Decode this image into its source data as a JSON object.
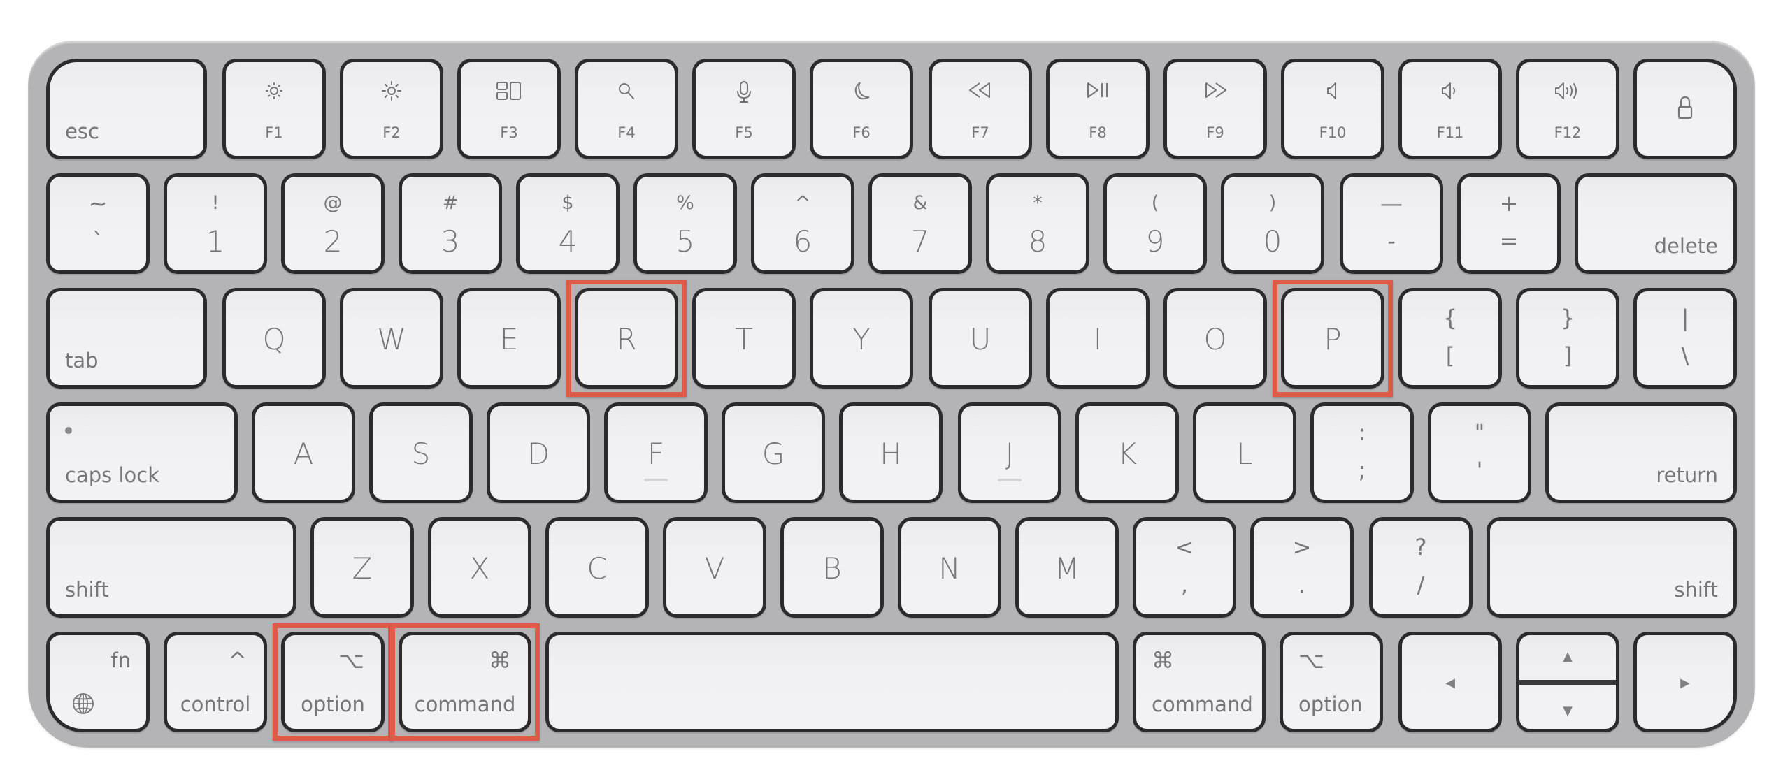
{
  "image": {
    "subject": "Apple Magic Keyboard layout with highlighted keys"
  },
  "colors": {
    "case": "#b4b4b6",
    "key_face": "#f1f1f4",
    "key_outline": "#2b2b2d",
    "legend": "#77777b",
    "highlight": "#e05a48"
  },
  "highlighted_keys": [
    "R",
    "P",
    "option-left",
    "command-left"
  ],
  "rows": [
    {
      "name": "function-row",
      "keys": [
        {
          "id": "esc",
          "label": "esc",
          "style": "mod-left"
        },
        {
          "id": "f1",
          "label": "F1",
          "icon": "brightness-down-icon",
          "style": "fkey"
        },
        {
          "id": "f2",
          "label": "F2",
          "icon": "brightness-up-icon",
          "style": "fkey"
        },
        {
          "id": "f3",
          "label": "F3",
          "icon": "mission-control-icon",
          "style": "fkey"
        },
        {
          "id": "f4",
          "label": "F4",
          "icon": "search-icon",
          "style": "fkey"
        },
        {
          "id": "f5",
          "label": "F5",
          "icon": "microphone-icon",
          "style": "fkey"
        },
        {
          "id": "f6",
          "label": "F6",
          "icon": "moon-icon",
          "style": "fkey"
        },
        {
          "id": "f7",
          "label": "F7",
          "icon": "rewind-icon",
          "style": "fkey"
        },
        {
          "id": "f8",
          "label": "F8",
          "icon": "play-pause-icon",
          "style": "fkey"
        },
        {
          "id": "f9",
          "label": "F9",
          "icon": "fast-forward-icon",
          "style": "fkey"
        },
        {
          "id": "f10",
          "label": "F10",
          "icon": "mute-icon",
          "style": "fkey"
        },
        {
          "id": "f11",
          "label": "F11",
          "icon": "volume-down-icon",
          "style": "fkey"
        },
        {
          "id": "f12",
          "label": "F12",
          "icon": "volume-up-icon",
          "style": "fkey"
        },
        {
          "id": "lock",
          "label": "",
          "icon": "lock-icon",
          "style": "lock"
        }
      ]
    },
    {
      "name": "number-row",
      "keys": [
        {
          "id": "grave",
          "top": "~",
          "bottom": "`",
          "style": "dual"
        },
        {
          "id": "1",
          "top": "!",
          "bottom": "1",
          "style": "dual-num"
        },
        {
          "id": "2",
          "top": "@",
          "bottom": "2",
          "style": "dual-num"
        },
        {
          "id": "3",
          "top": "#",
          "bottom": "3",
          "style": "dual-num"
        },
        {
          "id": "4",
          "top": "$",
          "bottom": "4",
          "style": "dual-num"
        },
        {
          "id": "5",
          "top": "%",
          "bottom": "5",
          "style": "dual-num"
        },
        {
          "id": "6",
          "top": "^",
          "bottom": "6",
          "style": "dual-num"
        },
        {
          "id": "7",
          "top": "&",
          "bottom": "7",
          "style": "dual-num"
        },
        {
          "id": "8",
          "top": "*",
          "bottom": "8",
          "style": "dual-num"
        },
        {
          "id": "9",
          "top": "(",
          "bottom": "9",
          "style": "dual-num"
        },
        {
          "id": "0",
          "top": ")",
          "bottom": "0",
          "style": "dual-num"
        },
        {
          "id": "minus",
          "top": "—",
          "bottom": "-",
          "style": "dual"
        },
        {
          "id": "equal",
          "top": "+",
          "bottom": "=",
          "style": "dual"
        },
        {
          "id": "delete",
          "label": "delete",
          "style": "mod-right"
        }
      ]
    },
    {
      "name": "qwerty-row",
      "keys": [
        {
          "id": "tab",
          "label": "tab",
          "style": "mod-left"
        },
        {
          "id": "Q",
          "label": "Q",
          "style": "letter"
        },
        {
          "id": "W",
          "label": "W",
          "style": "letter"
        },
        {
          "id": "E",
          "label": "E",
          "style": "letter"
        },
        {
          "id": "R",
          "label": "R",
          "style": "letter"
        },
        {
          "id": "T",
          "label": "T",
          "style": "letter"
        },
        {
          "id": "Y",
          "label": "Y",
          "style": "letter"
        },
        {
          "id": "U",
          "label": "U",
          "style": "letter"
        },
        {
          "id": "I",
          "label": "I",
          "style": "letter"
        },
        {
          "id": "O",
          "label": "O",
          "style": "letter"
        },
        {
          "id": "P",
          "label": "P",
          "style": "letter"
        },
        {
          "id": "lbracket",
          "top": "{",
          "bottom": "[",
          "style": "dual"
        },
        {
          "id": "rbracket",
          "top": "}",
          "bottom": "]",
          "style": "dual"
        },
        {
          "id": "backslash",
          "top": "|",
          "bottom": "\\",
          "style": "dual"
        }
      ]
    },
    {
      "name": "home-row",
      "keys": [
        {
          "id": "capslock",
          "label": "caps lock",
          "indicator": "caps-lock-indicator",
          "style": "mod-left"
        },
        {
          "id": "A",
          "label": "A",
          "style": "letter"
        },
        {
          "id": "S",
          "label": "S",
          "style": "letter"
        },
        {
          "id": "D",
          "label": "D",
          "style": "letter"
        },
        {
          "id": "F",
          "label": "F",
          "style": "letter",
          "bump": true
        },
        {
          "id": "G",
          "label": "G",
          "style": "letter"
        },
        {
          "id": "H",
          "label": "H",
          "style": "letter"
        },
        {
          "id": "J",
          "label": "J",
          "style": "letter",
          "bump": true
        },
        {
          "id": "K",
          "label": "K",
          "style": "letter"
        },
        {
          "id": "L",
          "label": "L",
          "style": "letter"
        },
        {
          "id": "semicolon",
          "top": ":",
          "bottom": ";",
          "style": "dual"
        },
        {
          "id": "quote",
          "top": "\"",
          "bottom": "'",
          "style": "dual"
        },
        {
          "id": "return",
          "label": "return",
          "style": "mod-right"
        }
      ]
    },
    {
      "name": "bottom-letter-row",
      "keys": [
        {
          "id": "shift-left",
          "label": "shift",
          "style": "mod-left"
        },
        {
          "id": "Z",
          "label": "Z",
          "style": "letter"
        },
        {
          "id": "X",
          "label": "X",
          "style": "letter"
        },
        {
          "id": "C",
          "label": "C",
          "style": "letter"
        },
        {
          "id": "V",
          "label": "V",
          "style": "letter"
        },
        {
          "id": "B",
          "label": "B",
          "style": "letter"
        },
        {
          "id": "N",
          "label": "N",
          "style": "letter"
        },
        {
          "id": "M",
          "label": "M",
          "style": "letter"
        },
        {
          "id": "comma",
          "top": "<",
          "bottom": ",",
          "style": "dual"
        },
        {
          "id": "period",
          "top": ">",
          "bottom": ".",
          "style": "dual"
        },
        {
          "id": "slash",
          "top": "?",
          "bottom": "/",
          "style": "dual"
        },
        {
          "id": "shift-right",
          "label": "shift",
          "style": "mod-right"
        }
      ]
    },
    {
      "name": "modifier-row",
      "keys": [
        {
          "id": "fn",
          "label": "fn",
          "icon": "globe-icon",
          "style": "fn"
        },
        {
          "id": "control",
          "label": "control",
          "symbol": "^",
          "style": "mod-sym-right"
        },
        {
          "id": "option-left",
          "label": "option",
          "symbol": "⌥",
          "style": "mod-sym-right"
        },
        {
          "id": "command-left",
          "label": "command",
          "symbol": "⌘",
          "style": "mod-sym-right"
        },
        {
          "id": "space",
          "label": "",
          "style": "space"
        },
        {
          "id": "command-right",
          "label": "command",
          "symbol": "⌘",
          "style": "mod-sym-left"
        },
        {
          "id": "option-right",
          "label": "option",
          "symbol": "⌥",
          "style": "mod-sym-left"
        },
        {
          "id": "arrow-left",
          "symbol": "◀",
          "style": "arrow"
        },
        {
          "id": "arrow-updown",
          "symbol_up": "▲",
          "symbol_down": "▼",
          "style": "arrow-updown"
        },
        {
          "id": "arrow-right",
          "symbol": "▶",
          "style": "arrow"
        }
      ]
    }
  ]
}
